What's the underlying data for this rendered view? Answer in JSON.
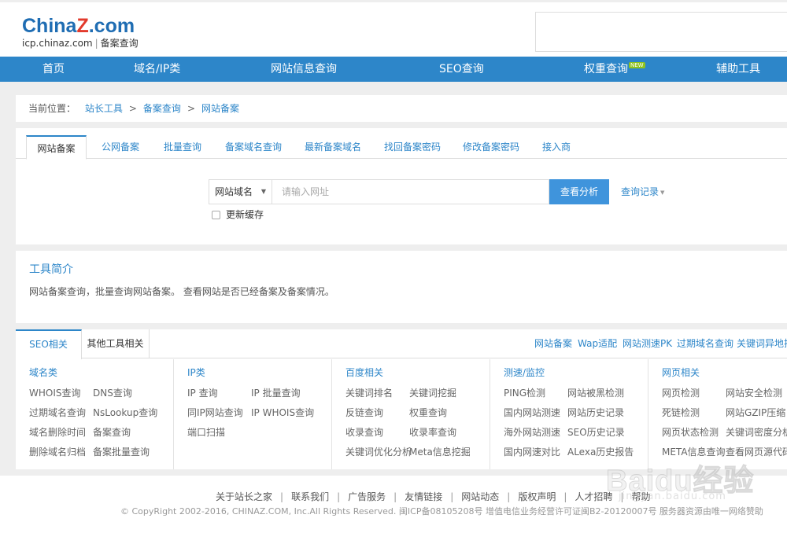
{
  "header": {
    "logo_china": "China",
    "logo_z": "Z",
    "logo_com": ".com",
    "logo_domain": "icp.chinaz.com",
    "logo_sep": "|",
    "logo_service": "备案查询"
  },
  "nav": {
    "items": [
      {
        "label": "首页"
      },
      {
        "label": "域名/IP类"
      },
      {
        "label": "网站信息查询"
      },
      {
        "label": "SEO查询"
      },
      {
        "label": "权重查询",
        "badge": "NEW"
      },
      {
        "label": "辅助工具"
      }
    ]
  },
  "breadcrumb": {
    "prefix": "当前位置：",
    "items": [
      "站长工具",
      "备案查询",
      "网站备案"
    ],
    "separator": ">"
  },
  "search": {
    "tabs": [
      "网站备案",
      "公网备案",
      "批量查询",
      "备案域名查询",
      "最新备案域名",
      "找回备案密码",
      "修改备案密码",
      "接入商"
    ],
    "select_value": "网站域名",
    "input_placeholder": "请输入网址",
    "button_label": "查看分析",
    "history_label": "查询记录",
    "refresh_label": "更新缓存"
  },
  "intro": {
    "title": "工具简介",
    "text": "网站备案查询，批量查询网站备案。 查看网站是否已经备案及备案情况。"
  },
  "related": {
    "tabs": [
      "SEO相关",
      "其他工具相关"
    ],
    "quick_links": [
      "网站备案",
      "Wap适配",
      "网站测速PK",
      "过期域名查询",
      "关键词异地排"
    ],
    "columns": [
      {
        "title": "域名类",
        "links": [
          "WHOIS查询",
          "DNS查询",
          "过期域名查询",
          "NsLookup查询",
          "域名删除时间",
          "备案查询",
          "删除域名归档",
          "备案批量查询"
        ]
      },
      {
        "title": "IP类",
        "links": [
          "IP 查询",
          "IP 批量查询",
          "同IP网站查询",
          "IP WHOIS查询",
          "端口扫描"
        ]
      },
      {
        "title": "百度相关",
        "links": [
          "关键词排名",
          "关键词挖掘",
          "反链查询",
          "权重查询",
          "收录查询",
          "收录率查询",
          "关键词优化分析",
          "Meta信息挖掘"
        ]
      },
      {
        "title": "测速/监控",
        "links": [
          "PING检测",
          "网站被黑检测",
          "国内网站测速",
          "网站历史记录",
          "海外网站测速",
          "SEO历史记录",
          "国内网速对比",
          "ALexa历史报告"
        ]
      },
      {
        "title": "网页相关",
        "links": [
          "网页检测",
          "网站安全检测",
          "死链检测",
          "网站GZIP压缩",
          "网页状态检测",
          "关键词密度分析",
          "META信息查询",
          "查看网页源代码"
        ]
      }
    ]
  },
  "footer": {
    "links": [
      "关于站长之家",
      "联系我们",
      "广告服务",
      "友情链接",
      "网站动态",
      "版权声明",
      "人才招聘",
      "帮助"
    ],
    "copyright": "© CopyRight 2002-2016, CHINAZ.COM, Inc.All Rights Reserved.   闽ICP备08105208号   增值电信业务经营许可证闽B2-20120007号   服务器资源由唯一网络赞助"
  },
  "watermark": {
    "text": "Baidu经验",
    "sub": "jingyan.baidu.com"
  }
}
